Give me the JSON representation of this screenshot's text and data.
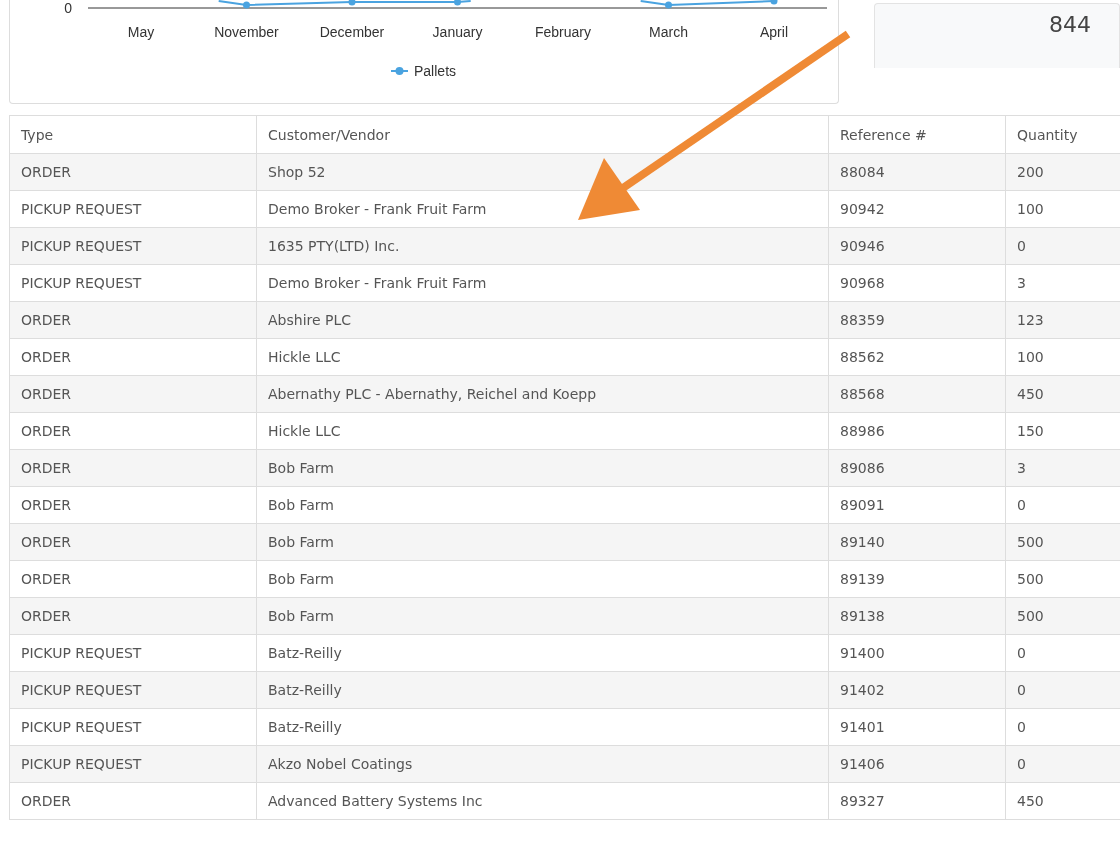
{
  "chart": {
    "y_tick": "0",
    "x_labels": [
      "May",
      "November",
      "December",
      "January",
      "February",
      "March",
      "April"
    ],
    "legend": "Pallets"
  },
  "summary_card": {
    "value": "844"
  },
  "table": {
    "columns": [
      "Type",
      "Customer/Vendor",
      "Reference #",
      "Quantity"
    ],
    "rows": [
      {
        "type": "ORDER",
        "customer": "Shop 52",
        "reference": "88084",
        "quantity": "200"
      },
      {
        "type": "PICKUP REQUEST",
        "customer": "Demo Broker - Frank Fruit Farm",
        "reference": "90942",
        "quantity": "100"
      },
      {
        "type": "PICKUP REQUEST",
        "customer": "1635 PTY(LTD) Inc.",
        "reference": "90946",
        "quantity": "0"
      },
      {
        "type": "PICKUP REQUEST",
        "customer": "Demo Broker - Frank Fruit Farm",
        "reference": "90968",
        "quantity": "3"
      },
      {
        "type": "ORDER",
        "customer": "Abshire PLC",
        "reference": "88359",
        "quantity": "123"
      },
      {
        "type": "ORDER",
        "customer": "Hickle LLC",
        "reference": "88562",
        "quantity": "100"
      },
      {
        "type": "ORDER",
        "customer": "Abernathy PLC - Abernathy, Reichel and Koepp",
        "reference": "88568",
        "quantity": "450"
      },
      {
        "type": "ORDER",
        "customer": "Hickle LLC",
        "reference": "88986",
        "quantity": "150"
      },
      {
        "type": "ORDER",
        "customer": "Bob Farm",
        "reference": "89086",
        "quantity": "3"
      },
      {
        "type": "ORDER",
        "customer": "Bob Farm",
        "reference": "89091",
        "quantity": "0"
      },
      {
        "type": "ORDER",
        "customer": "Bob Farm",
        "reference": "89140",
        "quantity": "500"
      },
      {
        "type": "ORDER",
        "customer": "Bob Farm",
        "reference": "89139",
        "quantity": "500"
      },
      {
        "type": "ORDER",
        "customer": "Bob Farm",
        "reference": "89138",
        "quantity": "500"
      },
      {
        "type": "PICKUP REQUEST",
        "customer": "Batz-Reilly",
        "reference": "91400",
        "quantity": "0"
      },
      {
        "type": "PICKUP REQUEST",
        "customer": "Batz-Reilly",
        "reference": "91402",
        "quantity": "0"
      },
      {
        "type": "PICKUP REQUEST",
        "customer": "Batz-Reilly",
        "reference": "91401",
        "quantity": "0"
      },
      {
        "type": "PICKUP REQUEST",
        "customer": "Akzo Nobel Coatings",
        "reference": "91406",
        "quantity": "0"
      },
      {
        "type": "ORDER",
        "customer": "Advanced Battery Systems Inc",
        "reference": "89327",
        "quantity": "450"
      }
    ]
  }
}
